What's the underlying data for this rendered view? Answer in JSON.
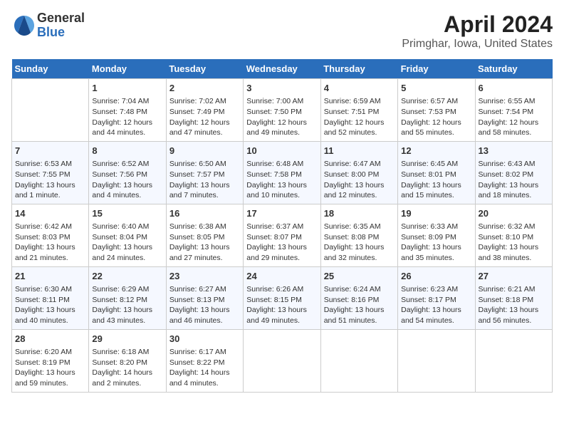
{
  "header": {
    "logo": {
      "general": "General",
      "blue": "Blue"
    },
    "title": "April 2024",
    "subtitle": "Primghar, Iowa, United States"
  },
  "calendar": {
    "headers": [
      "Sunday",
      "Monday",
      "Tuesday",
      "Wednesday",
      "Thursday",
      "Friday",
      "Saturday"
    ],
    "weeks": [
      [
        {
          "day": "",
          "info": ""
        },
        {
          "day": "1",
          "info": "Sunrise: 7:04 AM\nSunset: 7:48 PM\nDaylight: 12 hours\nand 44 minutes."
        },
        {
          "day": "2",
          "info": "Sunrise: 7:02 AM\nSunset: 7:49 PM\nDaylight: 12 hours\nand 47 minutes."
        },
        {
          "day": "3",
          "info": "Sunrise: 7:00 AM\nSunset: 7:50 PM\nDaylight: 12 hours\nand 49 minutes."
        },
        {
          "day": "4",
          "info": "Sunrise: 6:59 AM\nSunset: 7:51 PM\nDaylight: 12 hours\nand 52 minutes."
        },
        {
          "day": "5",
          "info": "Sunrise: 6:57 AM\nSunset: 7:53 PM\nDaylight: 12 hours\nand 55 minutes."
        },
        {
          "day": "6",
          "info": "Sunrise: 6:55 AM\nSunset: 7:54 PM\nDaylight: 12 hours\nand 58 minutes."
        }
      ],
      [
        {
          "day": "7",
          "info": "Sunrise: 6:53 AM\nSunset: 7:55 PM\nDaylight: 13 hours\nand 1 minute."
        },
        {
          "day": "8",
          "info": "Sunrise: 6:52 AM\nSunset: 7:56 PM\nDaylight: 13 hours\nand 4 minutes."
        },
        {
          "day": "9",
          "info": "Sunrise: 6:50 AM\nSunset: 7:57 PM\nDaylight: 13 hours\nand 7 minutes."
        },
        {
          "day": "10",
          "info": "Sunrise: 6:48 AM\nSunset: 7:58 PM\nDaylight: 13 hours\nand 10 minutes."
        },
        {
          "day": "11",
          "info": "Sunrise: 6:47 AM\nSunset: 8:00 PM\nDaylight: 13 hours\nand 12 minutes."
        },
        {
          "day": "12",
          "info": "Sunrise: 6:45 AM\nSunset: 8:01 PM\nDaylight: 13 hours\nand 15 minutes."
        },
        {
          "day": "13",
          "info": "Sunrise: 6:43 AM\nSunset: 8:02 PM\nDaylight: 13 hours\nand 18 minutes."
        }
      ],
      [
        {
          "day": "14",
          "info": "Sunrise: 6:42 AM\nSunset: 8:03 PM\nDaylight: 13 hours\nand 21 minutes."
        },
        {
          "day": "15",
          "info": "Sunrise: 6:40 AM\nSunset: 8:04 PM\nDaylight: 13 hours\nand 24 minutes."
        },
        {
          "day": "16",
          "info": "Sunrise: 6:38 AM\nSunset: 8:05 PM\nDaylight: 13 hours\nand 27 minutes."
        },
        {
          "day": "17",
          "info": "Sunrise: 6:37 AM\nSunset: 8:07 PM\nDaylight: 13 hours\nand 29 minutes."
        },
        {
          "day": "18",
          "info": "Sunrise: 6:35 AM\nSunset: 8:08 PM\nDaylight: 13 hours\nand 32 minutes."
        },
        {
          "day": "19",
          "info": "Sunrise: 6:33 AM\nSunset: 8:09 PM\nDaylight: 13 hours\nand 35 minutes."
        },
        {
          "day": "20",
          "info": "Sunrise: 6:32 AM\nSunset: 8:10 PM\nDaylight: 13 hours\nand 38 minutes."
        }
      ],
      [
        {
          "day": "21",
          "info": "Sunrise: 6:30 AM\nSunset: 8:11 PM\nDaylight: 13 hours\nand 40 minutes."
        },
        {
          "day": "22",
          "info": "Sunrise: 6:29 AM\nSunset: 8:12 PM\nDaylight: 13 hours\nand 43 minutes."
        },
        {
          "day": "23",
          "info": "Sunrise: 6:27 AM\nSunset: 8:13 PM\nDaylight: 13 hours\nand 46 minutes."
        },
        {
          "day": "24",
          "info": "Sunrise: 6:26 AM\nSunset: 8:15 PM\nDaylight: 13 hours\nand 49 minutes."
        },
        {
          "day": "25",
          "info": "Sunrise: 6:24 AM\nSunset: 8:16 PM\nDaylight: 13 hours\nand 51 minutes."
        },
        {
          "day": "26",
          "info": "Sunrise: 6:23 AM\nSunset: 8:17 PM\nDaylight: 13 hours\nand 54 minutes."
        },
        {
          "day": "27",
          "info": "Sunrise: 6:21 AM\nSunset: 8:18 PM\nDaylight: 13 hours\nand 56 minutes."
        }
      ],
      [
        {
          "day": "28",
          "info": "Sunrise: 6:20 AM\nSunset: 8:19 PM\nDaylight: 13 hours\nand 59 minutes."
        },
        {
          "day": "29",
          "info": "Sunrise: 6:18 AM\nSunset: 8:20 PM\nDaylight: 14 hours\nand 2 minutes."
        },
        {
          "day": "30",
          "info": "Sunrise: 6:17 AM\nSunset: 8:22 PM\nDaylight: 14 hours\nand 4 minutes."
        },
        {
          "day": "",
          "info": ""
        },
        {
          "day": "",
          "info": ""
        },
        {
          "day": "",
          "info": ""
        },
        {
          "day": "",
          "info": ""
        }
      ]
    ]
  }
}
